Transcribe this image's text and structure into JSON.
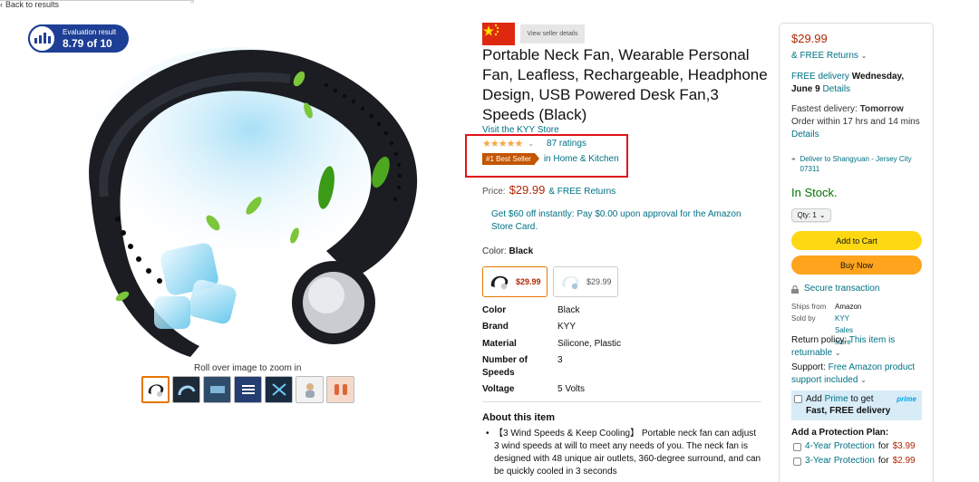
{
  "nav": {
    "back_label": "Back to results"
  },
  "evaluation": {
    "label": "Evaluation result",
    "score": "8.79 of 10"
  },
  "gallery": {
    "roll_over_text": "Roll over image to zoom in",
    "thumbnail_count": 7
  },
  "seller": {
    "view_button": "View seller details",
    "flag": "china-flag"
  },
  "product": {
    "title": "Portable Neck Fan, Wearable Personal Fan, Leafless, Rechargeable, Headphone Design, USB Powered Desk Fan,3 Speeds (Black)",
    "store_link": "Visit the KYY Store",
    "stars": "★★★★★",
    "ratings": "87 ratings",
    "best_seller_badge": "#1 Best Seller",
    "best_seller_category": "in Home & Kitchen",
    "price_label": "Price:",
    "price": "$29.99",
    "price_returns": "& FREE Returns",
    "promo": "Get $60 off instantly: Pay $0.00 upon approval for the Amazon Store Card.",
    "color_label": "Color:",
    "color_value": "Black",
    "swatches": [
      {
        "price": "$29.99",
        "selected": true
      },
      {
        "price": "$29.99",
        "selected": false
      }
    ],
    "specs": [
      {
        "key": "Color",
        "value": "Black"
      },
      {
        "key": "Brand",
        "value": "KYY"
      },
      {
        "key": "Material",
        "value": "Silicone, Plastic"
      },
      {
        "key": "Number of Speeds",
        "value": "3"
      },
      {
        "key": "Voltage",
        "value": "5 Volts"
      }
    ],
    "about_heading": "About this item",
    "about_bullet": "【3 Wind Speeds & Keep Cooling】 Portable neck fan can adjust 3 wind speeds at will to meet any needs of you. The neck fan is designed with 48 unique air outlets, 360-degree surround, and can be quickly cooled in 3 seconds"
  },
  "buybox": {
    "price": "$29.99",
    "returns": "& FREE Returns",
    "free_delivery_prefix": "FREE delivery",
    "free_delivery_date": "Wednesday, June 9",
    "details": "Details",
    "fastest_prefix": "Fastest delivery:",
    "fastest_date": "Tomorrow",
    "order_within": "Order within 17 hrs and 14 mins",
    "deliver_to": "Deliver to Shangyuan - Jersey City 07311",
    "stock": "In Stock.",
    "qty": "Qty: 1",
    "add_to_cart": "Add to Cart",
    "buy_now": "Buy Now",
    "secure": "Secure transaction",
    "ships_from_label": "Ships from",
    "ships_from_value": "Amazon",
    "sold_by_label": "Sold by",
    "sold_by_value": "KYY Sales store",
    "return_policy_label": "Return policy:",
    "return_policy_link": "This item is returnable",
    "support_label": "Support:",
    "support_link": "Free Amazon product support included",
    "prime_add": "Add",
    "prime_word": "Prime",
    "prime_to_get": "to get",
    "prime_fast": "Fast, FREE delivery",
    "prime_logo": "prime",
    "protection_heading": "Add a Protection Plan:",
    "plan1_label": "4-Year Protection",
    "plan1_for": "for",
    "plan1_price": "$3.99",
    "plan2_label": "3-Year Protection",
    "plan2_for": "for",
    "plan2_price": "$2.99"
  },
  "colors": {
    "price_red": "#b12704",
    "link_teal": "#007185",
    "stock_green": "#007600",
    "cart_yellow": "#ffd814",
    "buy_orange": "#ffa41c",
    "badge_orange": "#c45500",
    "highlight_red": "#e1141a",
    "eval_blue": "#1d3f95"
  }
}
